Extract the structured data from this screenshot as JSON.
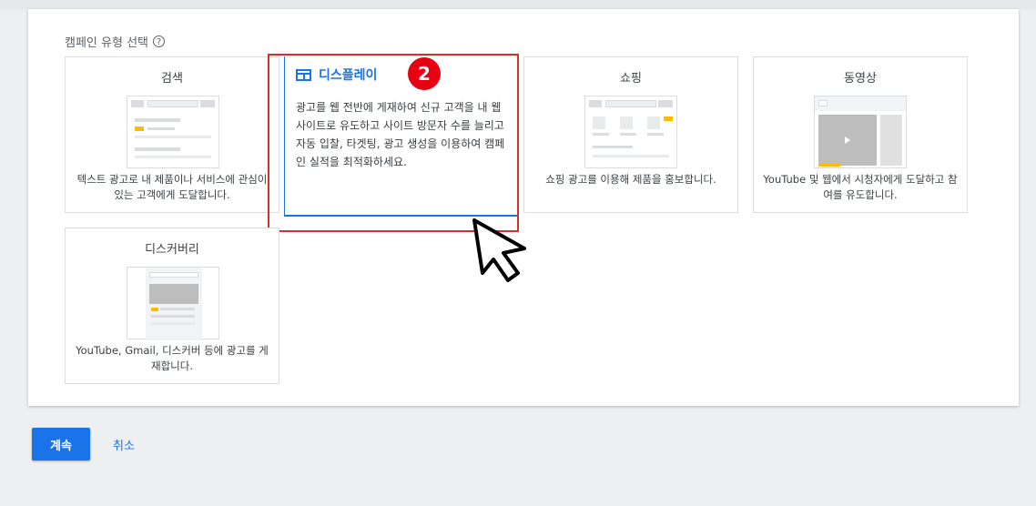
{
  "section": {
    "title": "캠페인 유형 선택",
    "help_icon": "?"
  },
  "cards": {
    "search": {
      "title": "검색",
      "desc": "텍스트 광고로 내 제품이나 서비스에 관심이 있는 고객에게 도달합니다."
    },
    "display": {
      "title": "디스플레이",
      "desc": "광고를 웹 전반에 게재하여 신규 고객을 내 웹사이트로 유도하고 사이트 방문자 수를 늘리고 자동 입찰, 타겟팅, 광고 생성을 이용하여 캠페인 실적을 최적화하세요."
    },
    "shopping": {
      "title": "쇼핑",
      "desc": "쇼핑 광고를 이용해 제품을 홍보합니다."
    },
    "video": {
      "title": "동영상",
      "desc": "YouTube 및 웹에서 시청자에게 도달하고 참여를 유도합니다."
    },
    "discovery": {
      "title": "디스커버리",
      "desc": "YouTube, Gmail, 디스커버 등에 광고를 게재합니다."
    }
  },
  "step_badge": "2",
  "buttons": {
    "continue": "계속",
    "cancel": "취소"
  },
  "colors": {
    "accent": "#1a73e8",
    "highlight": "#d93025",
    "badge": "#e60012",
    "ad_yellow": "#fbbc04"
  }
}
